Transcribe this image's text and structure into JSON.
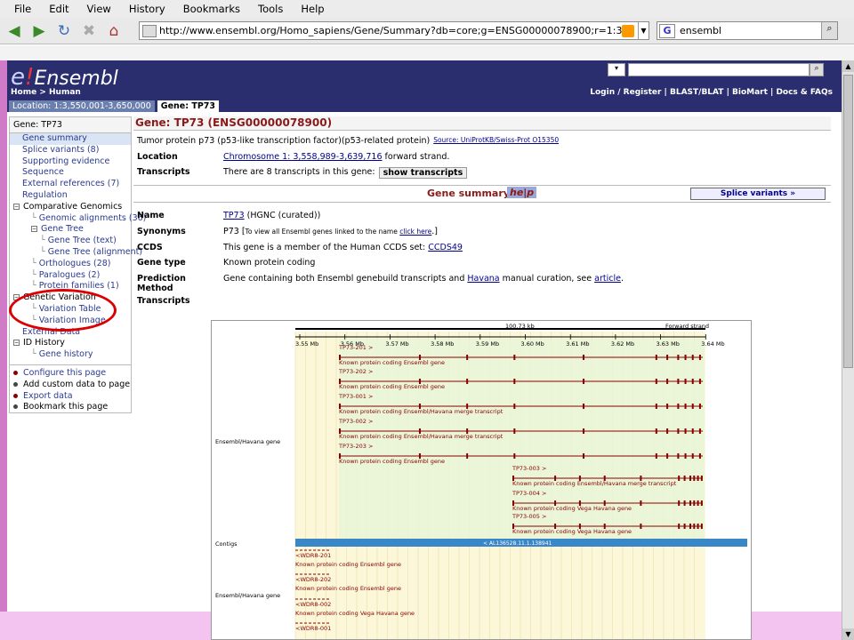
{
  "menu": [
    "File",
    "Edit",
    "View",
    "History",
    "Bookmarks",
    "Tools",
    "Help"
  ],
  "url": "http://www.ensembl.org/Homo_sapiens/Gene/Summary?db=core;g=ENSG00000078900;r=1:3550001-3650000",
  "browser_search": "ensembl",
  "site": {
    "logo_e": "e",
    "logo_excl": "!",
    "logo_text": "Ensembl",
    "breadcrumb": "Home > Human",
    "toplinks": "Login / Register  |  BLAST/BLAT  |  BioMart  |  Docs & FAQs"
  },
  "tabs": [
    "Location: 1:3,550,001-3,650,000",
    "Gene: TP73"
  ],
  "leftnav": {
    "header": "Gene: TP73",
    "items": [
      {
        "label": "Gene summary",
        "indent": 1,
        "sel": true,
        "icon": ""
      },
      {
        "label": "Splice variants (8)",
        "indent": 1,
        "icon": ""
      },
      {
        "label": "Supporting evidence",
        "indent": 1,
        "icon": ""
      },
      {
        "label": "Sequence",
        "indent": 1,
        "icon": ""
      },
      {
        "label": "External references (7)",
        "indent": 1,
        "icon": ""
      },
      {
        "label": "Regulation",
        "indent": 1,
        "icon": ""
      },
      {
        "label": "Comparative Genomics",
        "indent": 0,
        "icon": "−",
        "plain": true
      },
      {
        "label": "Genomic alignments (36)",
        "indent": 2,
        "icon": ""
      },
      {
        "label": "Gene Tree",
        "indent": 2,
        "icon": "−"
      },
      {
        "label": "Gene Tree (text)",
        "indent": 3,
        "icon": ""
      },
      {
        "label": "Gene Tree (alignment)",
        "indent": 3,
        "icon": ""
      },
      {
        "label": "Orthologues (28)",
        "indent": 2,
        "icon": ""
      },
      {
        "label": "Paralogues (2)",
        "indent": 2,
        "icon": ""
      },
      {
        "label": "Protein families (1)",
        "indent": 2,
        "icon": ""
      },
      {
        "label": "Genetic Variation",
        "indent": 0,
        "icon": "−",
        "plain": true
      },
      {
        "label": "Variation Table",
        "indent": 2,
        "icon": ""
      },
      {
        "label": "Variation Image",
        "indent": 2,
        "icon": ""
      },
      {
        "label": "External Data",
        "indent": 1,
        "icon": ""
      },
      {
        "label": "ID History",
        "indent": 0,
        "icon": "−",
        "plain": true
      },
      {
        "label": "Gene history",
        "indent": 2,
        "icon": ""
      }
    ],
    "actions": [
      {
        "label": "Configure this page",
        "link": true
      },
      {
        "label": "Add custom data to page",
        "link": false
      },
      {
        "label": "Export data",
        "link": true
      },
      {
        "label": "Bookmark this page",
        "link": false
      }
    ]
  },
  "gene": {
    "title": "Gene: TP73 (ENSG00000078900)",
    "description": "Tumor protein p73 (p53-like transcription factor)(p53-related protein)",
    "source": "Source: UniProtKB/Swiss-Prot O15350",
    "location_label": "Location",
    "location_link": "Chromosome 1: 3,558,989-3,639,716",
    "location_rest": " forward strand.",
    "transcripts_label": "Transcripts",
    "transcripts_text": "There are 8 transcripts in this gene:",
    "show_transcripts": "show transcripts"
  },
  "summary": {
    "title": "Gene summary",
    "help": "he|p",
    "splice_btn": "Splice variants »",
    "name_label": "Name",
    "name_link": "TP73",
    "name_rest": " (HGNC (curated))",
    "synonyms_label": "Synonyms",
    "synonyms_text": "P73 [",
    "synonyms_small": "To view all Ensembl genes linked to the name ",
    "synonyms_click": "click here",
    "synonyms_end": ".]",
    "ccds_label": "CCDS",
    "ccds_text": "This gene is a member of the Human CCDS set: ",
    "ccds_link": "CCDS49",
    "genetype_label": "Gene type",
    "genetype_text": "Known protein coding",
    "prediction_label": "Prediction Method",
    "prediction_text_a": "Gene containing both Ensembl genebuild transcripts and ",
    "prediction_link1": "Havana",
    "prediction_text_b": " manual curation, see ",
    "prediction_link2": "article",
    "prediction_text_c": ".",
    "transcripts_heading": "Transcripts"
  },
  "plot": {
    "scale_label": "100.73 kb",
    "strand_label": "Forward strand",
    "ticks": [
      "3.55 Mb",
      "3.56 Mb",
      "3.57 Mb",
      "3.58 Mb",
      "3.59 Mb",
      "3.60 Mb",
      "3.61 Mb",
      "3.62 Mb",
      "3.63 Mb",
      "3.64 Mb"
    ],
    "track_ensembl": "Ensembl/Havana gene",
    "track_contigs": "Contigs",
    "track_ensembl2": "Ensembl/Havana gene",
    "contig_label": "< AL136528.11.1.138941",
    "transcripts": [
      {
        "name": "TP73-201 >",
        "desc": "Known protein coding Ensembl gene"
      },
      {
        "name": "TP73-202 >",
        "desc": "Known protein coding Ensembl gene"
      },
      {
        "name": "TP73-001 >",
        "desc": "Known protein coding Ensembl/Havana merge transcript"
      },
      {
        "name": "TP73-002 >",
        "desc": "Known protein coding Ensembl/Havana merge transcript"
      },
      {
        "name": "TP73-203 >",
        "desc": "Known protein coding Ensembl gene"
      },
      {
        "name": "TP73-003 >",
        "desc": "Known protein coding Ensembl/Havana merge transcript"
      },
      {
        "name": "TP73-004 >",
        "desc": "Known protein coding Vega Havana gene"
      },
      {
        "name": "TP73-005 >",
        "desc": "Known protein coding Vega Havana gene"
      }
    ],
    "reverse": [
      {
        "name": "<WDR8-201",
        "desc": "Known protein coding Ensembl gene"
      },
      {
        "name": "<WDR8-202",
        "desc": "Known protein coding Ensembl gene"
      },
      {
        "name": "<WDR8-002",
        "desc": "Known protein coding Vega Havana gene"
      },
      {
        "name": "<WDR8-001",
        "desc": ""
      }
    ]
  }
}
